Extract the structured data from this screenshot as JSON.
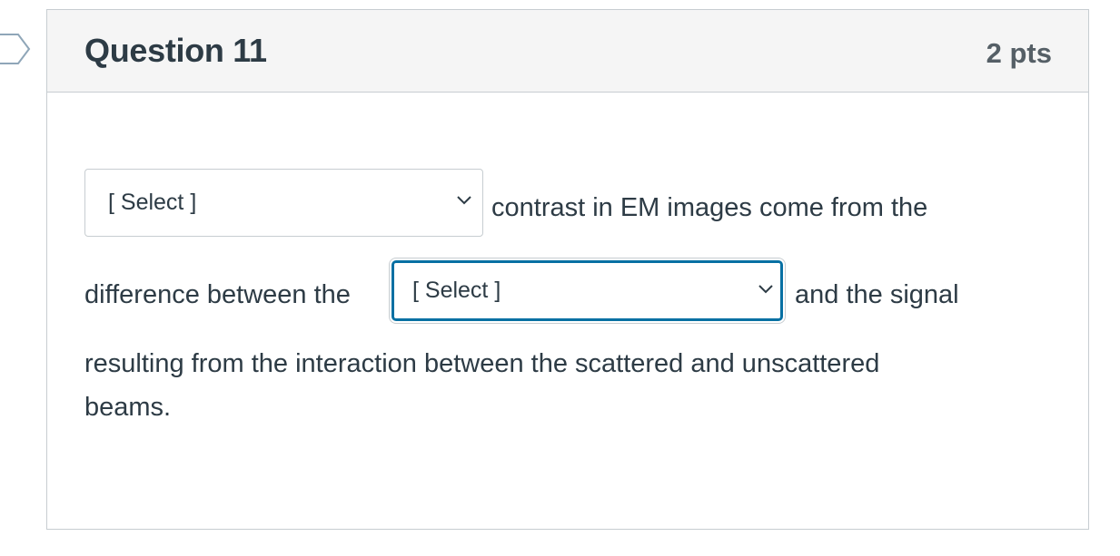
{
  "question": {
    "title": "Question 11",
    "points": "2 pts"
  },
  "body": {
    "select_1": {
      "selected": "[ Select ]"
    },
    "text_1": "contrast in EM images come from the",
    "text_2": "difference between the",
    "select_2": {
      "selected": "[ Select ]"
    },
    "text_3": "and the signal",
    "text_4": "resulting from the interaction between the scattered and unscattered",
    "text_5": "beams."
  },
  "icons": {
    "flag": "flag-marker-icon",
    "dropdown": "chevron-down-icon"
  },
  "colors": {
    "header_bg": "#f5f5f5",
    "border": "#c7cdd1",
    "focus": "#0770a3",
    "text": "#2d3b45",
    "points_text": "#555f66"
  }
}
